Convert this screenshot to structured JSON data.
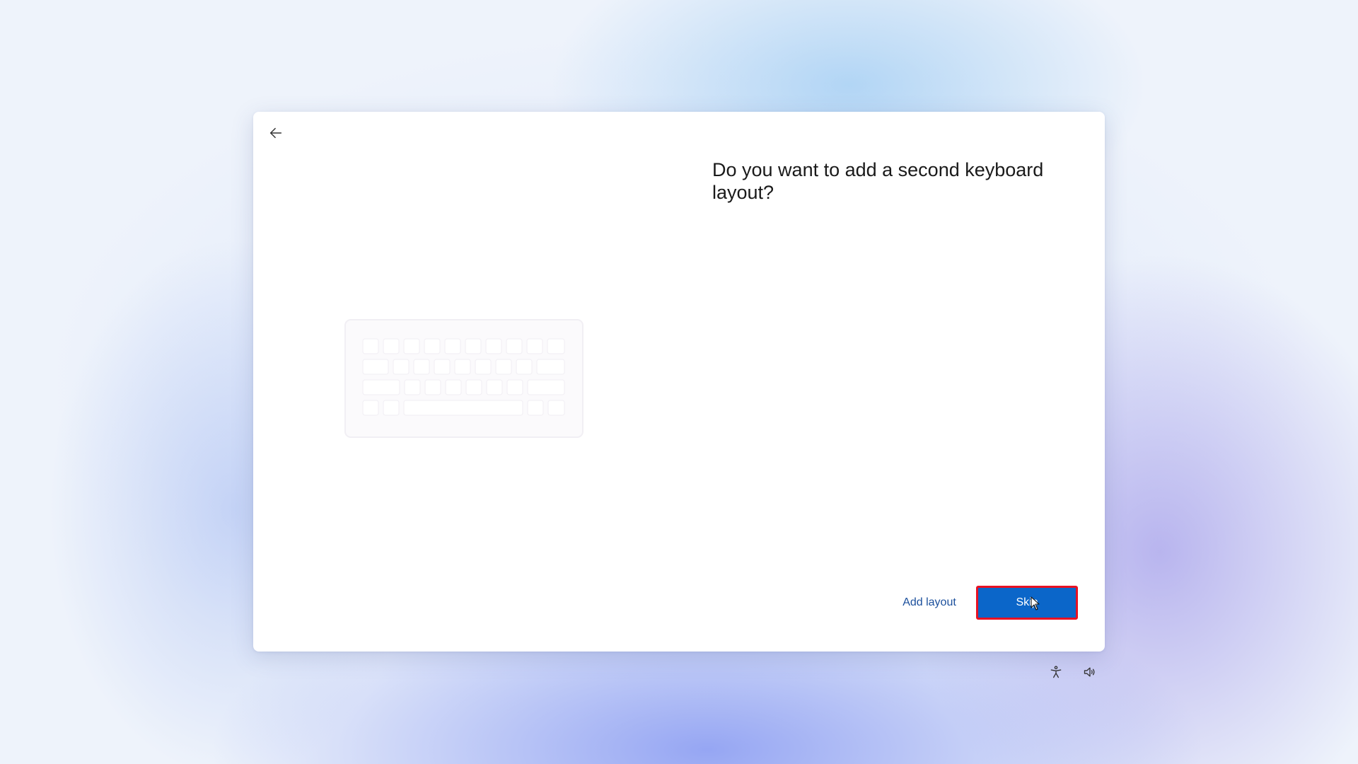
{
  "dialog": {
    "title": "Do you want to add a second keyboard layout?",
    "back_icon": "back-arrow-icon",
    "illustration": "keyboard-illustration"
  },
  "actions": {
    "add_layout_label": "Add layout",
    "skip_label": "Skip",
    "skip_highlight_color": "#e81123",
    "primary_color": "#0b66c9",
    "link_color": "#1b4f9c"
  },
  "tray": {
    "accessibility_icon": "accessibility-icon",
    "volume_icon": "volume-icon"
  }
}
